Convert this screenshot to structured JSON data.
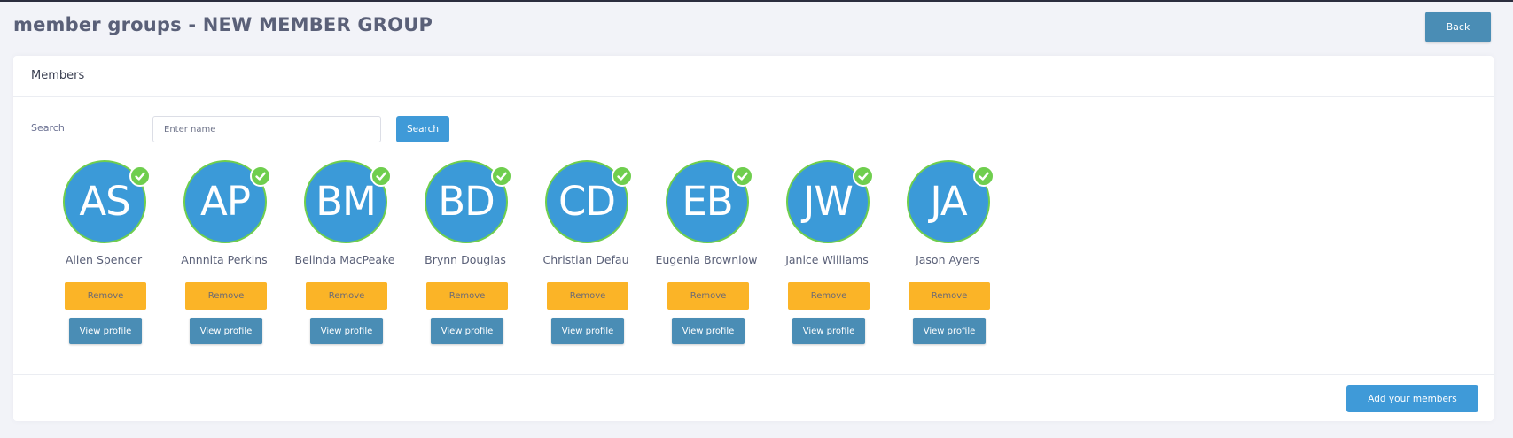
{
  "header": {
    "title": "member groups - NEW MEMBER GROUP",
    "back_label": "Back"
  },
  "card": {
    "title": "Members",
    "search_label": "Search",
    "search_placeholder": "Enter name",
    "search_button": "Search",
    "add_members_button": "Add your members"
  },
  "colors": {
    "primary": "#3f9ad8",
    "secondary": "#4a8db5",
    "warning": "#fbb427",
    "success": "#6fce4e"
  },
  "members": [
    {
      "initials": "AS",
      "name": "Allen Spencer",
      "remove_label": "Remove",
      "profile_label": "View profile",
      "status_icon": "check-icon"
    },
    {
      "initials": "AP",
      "name": "Annnita Perkins",
      "remove_label": "Remove",
      "profile_label": "View profile",
      "status_icon": "check-icon"
    },
    {
      "initials": "BM",
      "name": "Belinda MacPeake",
      "remove_label": "Remove",
      "profile_label": "View profile",
      "status_icon": "check-icon"
    },
    {
      "initials": "BD",
      "name": "Brynn Douglas",
      "remove_label": "Remove",
      "profile_label": "View profile",
      "status_icon": "check-icon"
    },
    {
      "initials": "CD",
      "name": "Christian Defau",
      "remove_label": "Remove",
      "profile_label": "View profile",
      "status_icon": "check-icon"
    },
    {
      "initials": "EB",
      "name": "Eugenia Brownlow",
      "remove_label": "Remove",
      "profile_label": "View profile",
      "status_icon": "check-icon"
    },
    {
      "initials": "JW",
      "name": "Janice Williams",
      "remove_label": "Remove",
      "profile_label": "View profile",
      "status_icon": "check-icon"
    },
    {
      "initials": "JA",
      "name": "Jason Ayers",
      "remove_label": "Remove",
      "profile_label": "View profile",
      "status_icon": "check-icon"
    }
  ]
}
